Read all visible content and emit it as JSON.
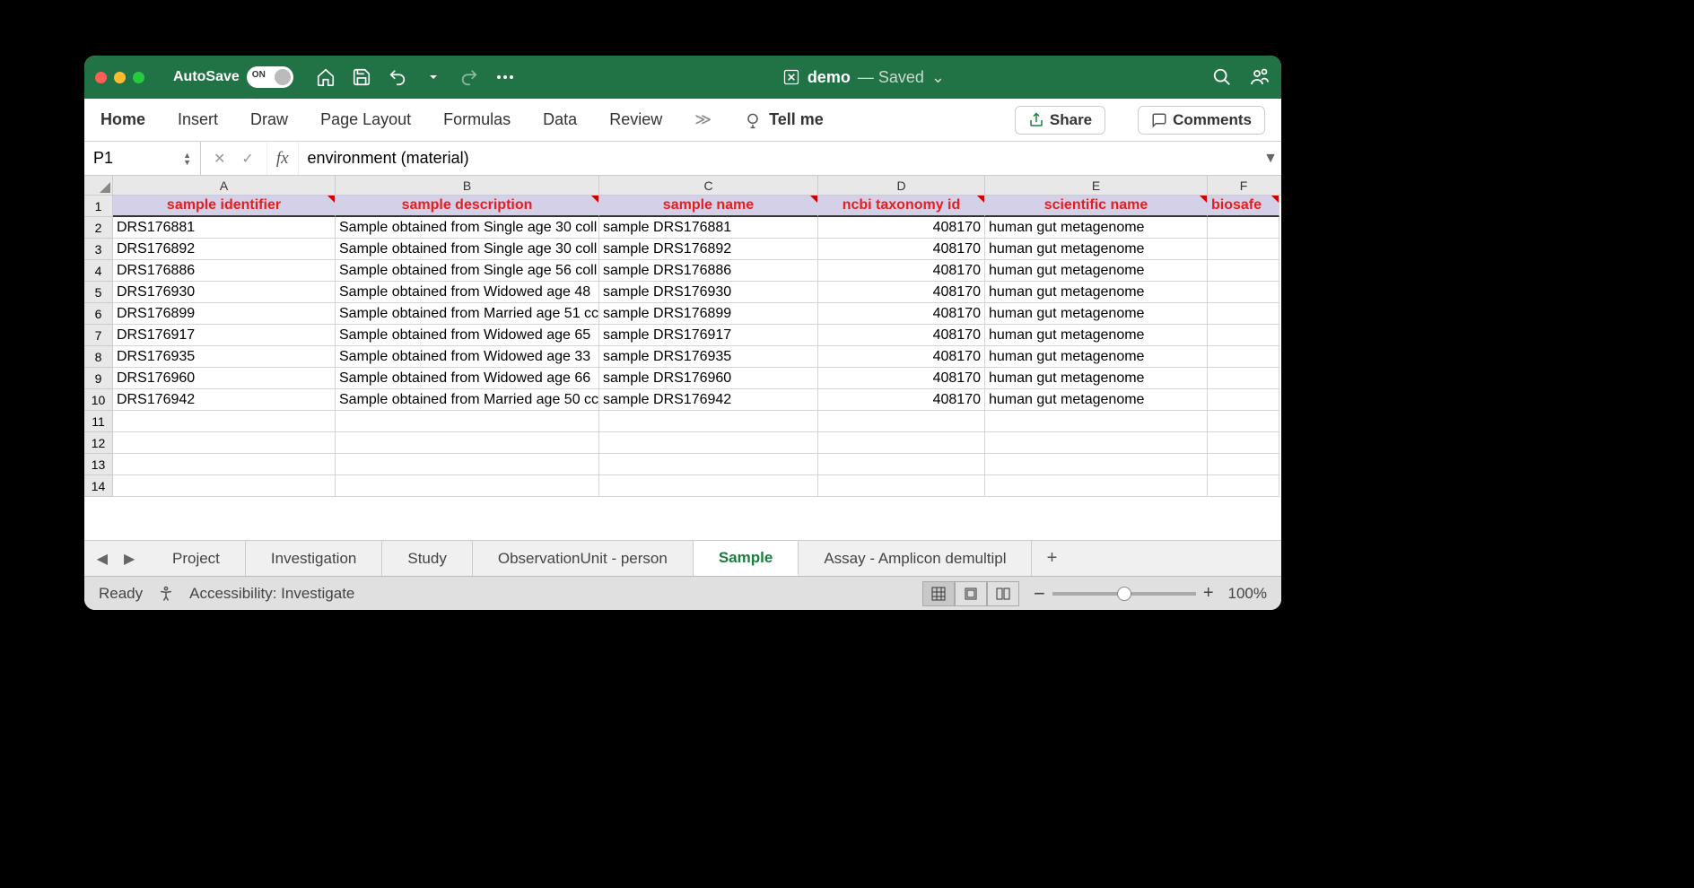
{
  "titlebar": {
    "autosave_label": "AutoSave",
    "autosave_state": "ON",
    "doc_name": "demo",
    "doc_status": "— Saved"
  },
  "ribbon": {
    "tabs": [
      "Home",
      "Insert",
      "Draw",
      "Page Layout",
      "Formulas",
      "Data",
      "Review"
    ],
    "tellme": "Tell me",
    "share": "Share",
    "comments": "Comments"
  },
  "formula_bar": {
    "cell_ref": "P1",
    "fx_label": "fx",
    "content": "environment (material)"
  },
  "columns": [
    "A",
    "B",
    "C",
    "D",
    "E",
    "F"
  ],
  "header_row": {
    "a": "sample identifier",
    "b": "sample description",
    "c": "sample name",
    "d": "ncbi taxonomy id",
    "e": "scientific name",
    "f": "biosafe"
  },
  "rows": [
    {
      "n": 2,
      "a": "DRS176881",
      "b": "Sample obtained from Single age 30 coll",
      "c": "sample DRS176881",
      "d": "408170",
      "e": "human gut metagenome"
    },
    {
      "n": 3,
      "a": "DRS176892",
      "b": "Sample obtained from Single age 30 coll",
      "c": "sample DRS176892",
      "d": "408170",
      "e": "human gut metagenome"
    },
    {
      "n": 4,
      "a": "DRS176886",
      "b": "Sample obtained from Single age 56 coll",
      "c": "sample DRS176886",
      "d": "408170",
      "e": "human gut metagenome"
    },
    {
      "n": 5,
      "a": "DRS176930",
      "b": "Sample obtained from Widowed age 48 ",
      "c": "sample DRS176930",
      "d": "408170",
      "e": "human gut metagenome"
    },
    {
      "n": 6,
      "a": "DRS176899",
      "b": "Sample obtained from Married age 51 cc",
      "c": "sample DRS176899",
      "d": "408170",
      "e": "human gut metagenome"
    },
    {
      "n": 7,
      "a": "DRS176917",
      "b": "Sample obtained from Widowed age 65 ",
      "c": "sample DRS176917",
      "d": "408170",
      "e": "human gut metagenome"
    },
    {
      "n": 8,
      "a": "DRS176935",
      "b": "Sample obtained from Widowed age 33 ",
      "c": "sample DRS176935",
      "d": "408170",
      "e": "human gut metagenome"
    },
    {
      "n": 9,
      "a": "DRS176960",
      "b": "Sample obtained from Widowed age 66 ",
      "c": "sample DRS176960",
      "d": "408170",
      "e": "human gut metagenome"
    },
    {
      "n": 10,
      "a": "DRS176942",
      "b": "Sample obtained from Married age 50 cc",
      "c": "sample DRS176942",
      "d": "408170",
      "e": "human gut metagenome"
    }
  ],
  "empty_rows": [
    11,
    12,
    13,
    14
  ],
  "sheets": [
    "Project",
    "Investigation",
    "Study",
    "ObservationUnit - person",
    "Sample",
    "Assay - Amplicon demultipl"
  ],
  "active_sheet": "Sample",
  "status": {
    "ready": "Ready",
    "accessibility": "Accessibility: Investigate",
    "zoom": "100%"
  }
}
